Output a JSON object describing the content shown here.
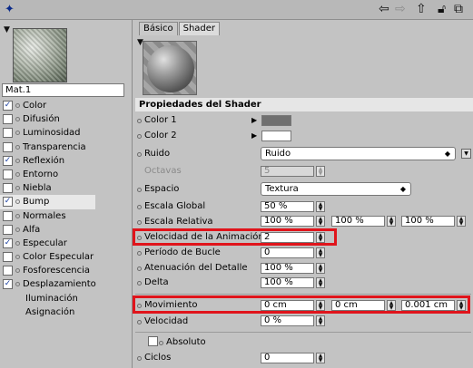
{
  "toolbar": {
    "pin_icon": "pin-icon",
    "back_icon": "arrow-left-icon",
    "forward_icon": "arrow-right-icon",
    "up_icon": "arrow-up-icon",
    "lock_icon": "lock-icon",
    "new_window_icon": "new-window-icon"
  },
  "material": {
    "name": "Mat.1",
    "channels": [
      {
        "label": "Color",
        "checked": true,
        "selected": false
      },
      {
        "label": "Difusión",
        "checked": false,
        "selected": false
      },
      {
        "label": "Luminosidad",
        "checked": false,
        "selected": false
      },
      {
        "label": "Transparencia",
        "checked": false,
        "selected": false
      },
      {
        "label": "Reflexión",
        "checked": true,
        "selected": false
      },
      {
        "label": "Entorno",
        "checked": false,
        "selected": false
      },
      {
        "label": "Niebla",
        "checked": false,
        "selected": false
      },
      {
        "label": "Bump",
        "checked": true,
        "selected": true
      },
      {
        "label": "Normales",
        "checked": false,
        "selected": false
      },
      {
        "label": "Alfa",
        "checked": false,
        "selected": false
      },
      {
        "label": "Especular",
        "checked": true,
        "selected": false
      },
      {
        "label": "Color Especular",
        "checked": false,
        "selected": false
      },
      {
        "label": "Fosforescencia",
        "checked": false,
        "selected": false
      },
      {
        "label": "Desplazamiento",
        "checked": true,
        "selected": false
      }
    ],
    "extra_items": [
      "Iluminación",
      "Asignación"
    ]
  },
  "tabs": [
    "Básico",
    "Shader"
  ],
  "section_title": "Propiedades del Shader",
  "props": {
    "color1": {
      "label": "Color 1",
      "swatch": "#707070"
    },
    "color2": {
      "label": "Color 2",
      "swatch": "#ffffff"
    },
    "ruido": {
      "label": "Ruido",
      "value": "Ruido"
    },
    "octavas": {
      "label": "Octavas",
      "value": "5"
    },
    "espacio": {
      "label": "Espacio",
      "value": "Textura"
    },
    "escala_global": {
      "label": "Escala Global",
      "value": "50 %"
    },
    "escala_relativa": {
      "label": "Escala Relativa",
      "values": [
        "100 %",
        "100 %",
        "100 %"
      ]
    },
    "velocidad_anim": {
      "label": "Velocidad de la Animación",
      "value": "2"
    },
    "periodo_bucle": {
      "label": "Período de Bucle",
      "value": "0"
    },
    "atenuacion": {
      "label": "Atenuación del Detalle",
      "value": "100 %"
    },
    "delta": {
      "label": "Delta",
      "value": "100 %"
    },
    "movimiento": {
      "label": "Movimiento",
      "values": [
        "0 cm",
        "0 cm",
        "0.001 cm"
      ]
    },
    "velocidad": {
      "label": "Velocidad",
      "value": "0 %"
    },
    "absoluto": {
      "label": "Absoluto",
      "checked": false
    },
    "ciclos": {
      "label": "Ciclos",
      "value": "0"
    }
  },
  "highlight_color": "#e0141b"
}
